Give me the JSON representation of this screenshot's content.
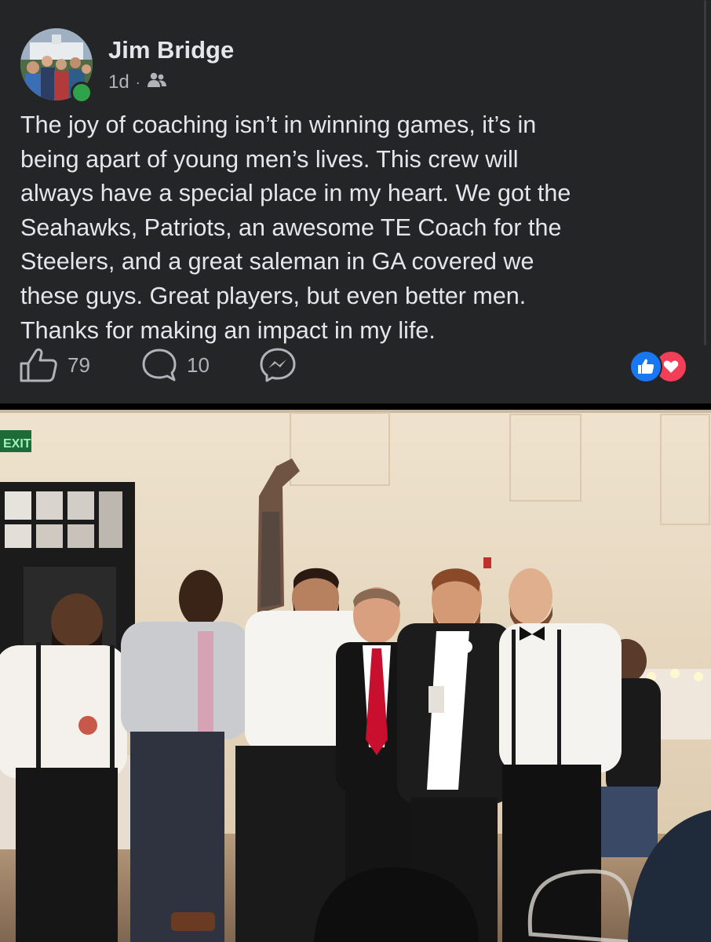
{
  "post": {
    "author": "Jim Bridge",
    "time": "1d",
    "separator": "·",
    "audience_icon": "friends-icon",
    "text": "The joy of coaching isn’t in winning games, it’s in\nbeing apart of young men’s lives.  This crew will\nalways have a special place in my heart.  We got the\nSeahawks, Patriots, an awesome TE Coach for the\nSteelers, and a great saleman in GA covered we\nthese guys.  Great players, but even better men.\nThanks for making an impact in my life.",
    "likes": "79",
    "comments": "10",
    "reactions": [
      "like-icon",
      "love-icon"
    ]
  },
  "photo": {
    "exit_sign": "EXIT"
  },
  "colors": {
    "post_bg": "#242526",
    "text": "#e4e6eb",
    "secondary_text": "#b0b3b8",
    "online": "#31a24c",
    "like": "#1877f2",
    "love": "#f33e58"
  }
}
